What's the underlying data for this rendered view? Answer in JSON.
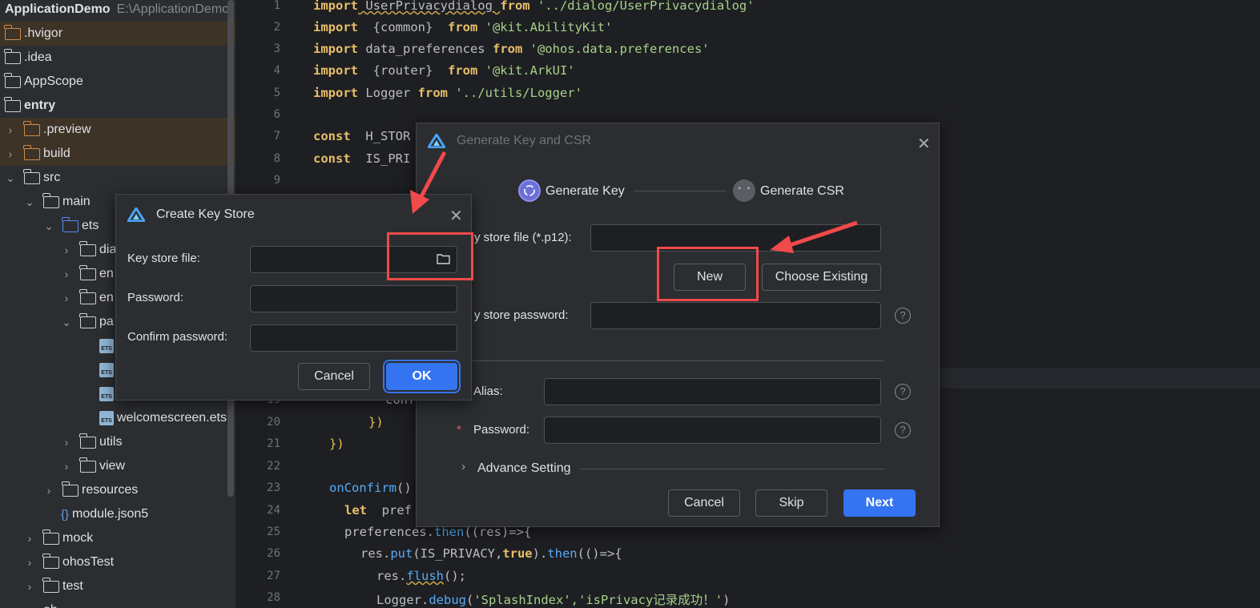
{
  "tree": {
    "project_name": "ApplicationDemo",
    "project_path": "E:\\ApplicationDemo",
    "items": [
      {
        "label": ".hvigor"
      },
      {
        "label": ".idea"
      },
      {
        "label": "AppScope"
      },
      {
        "label": "entry"
      },
      {
        "label": ".preview"
      },
      {
        "label": "build"
      },
      {
        "label": "src"
      },
      {
        "label": "main"
      },
      {
        "label": "ets"
      },
      {
        "label": "dia"
      },
      {
        "label": "en"
      },
      {
        "label": "en"
      },
      {
        "label": "pa"
      },
      {
        "label": ""
      },
      {
        "label": ""
      },
      {
        "label": ""
      },
      {
        "label": "welcomescreen.ets"
      },
      {
        "label": "utils"
      },
      {
        "label": "view"
      },
      {
        "label": "resources"
      },
      {
        "label": "module.json5"
      },
      {
        "label": "mock"
      },
      {
        "label": "ohosTest"
      },
      {
        "label": "test"
      },
      {
        "label": "oh"
      }
    ]
  },
  "editor": {
    "line_numbers": [
      "1",
      "2",
      "3",
      "4",
      "5",
      "6",
      "7",
      "8",
      "9",
      "19",
      "20",
      "21",
      "22",
      "23",
      "24",
      "25",
      "26",
      "27",
      "28"
    ],
    "code": {
      "l1_kw": "import",
      "l1_a": " UserPrivacydialog ",
      "l1_from": "from",
      "l1_str": " '../dialog/UserPrivacydialog'",
      "l2_kw": "import",
      "l2_a": "  {common}  ",
      "l2_from": "from",
      "l2_str": " '@kit.AbilityKit'",
      "l3_kw": "import",
      "l3_a": " data_preferences ",
      "l3_from": "from",
      "l3_str": " '@ohos.data.preferences'",
      "l4_kw": "import",
      "l4_a": "  {router}  ",
      "l4_from": "from",
      "l4_str": " '@kit.ArkUI'",
      "l5_kw": "import",
      "l5_a": " Logger ",
      "l5_from": "from",
      "l5_str": " '../utils/Logger'",
      "l7_kw": "const",
      "l7_a": "  H_STOR",
      "l8_kw": "const",
      "l8_a": "  IS_PRI",
      "l19": "conf",
      "l20": "})",
      "l21": "})",
      "l23_fn": "onConfirm",
      "l23_a": "()",
      "l24_kw": "let",
      "l24_a": "  pref",
      "l25_a": "preferences.",
      "l25_fn": "then",
      "l25_b": "((res)=>{",
      "l26_a": "res.",
      "l26_fn": "put",
      "l26_b": "(IS_PRIVACY,",
      "l26_kw": "true",
      "l26_c": ").",
      "l26_fn2": "then",
      "l26_d": "(()=>{",
      "l27_a": "res.",
      "l27_fn": "flush",
      "l27_b": "();",
      "l28_a": "Logger.",
      "l28_fn": "debug",
      "l28_b": "(",
      "l28_str": "'SplashIndex','isPrivacy记录成功！'",
      "l28_c": ")"
    }
  },
  "gen_dialog": {
    "title": "Generate Key and CSR",
    "step1": "Generate Key",
    "step2": "Generate CSR",
    "keystore_label": "y store file (*.p12):",
    "new_label": "New",
    "choose_label": "Choose Existing",
    "keystore_pw_label": "y store password:",
    "alias_label": "Alias:",
    "password_label": "Password:",
    "required_mark": "*",
    "advance_label": "Advance Setting",
    "cancel_label": "Cancel",
    "skip_label": "Skip",
    "next_label": "Next"
  },
  "key_dialog": {
    "title": "Create Key Store",
    "keystore_label": "Key store file:",
    "password_label": "Password:",
    "confirm_label": "Confirm password:",
    "cancel_label": "Cancel",
    "ok_label": "OK"
  },
  "colors": {
    "accent": "#3574f0",
    "annotation": "#f04a4a"
  }
}
